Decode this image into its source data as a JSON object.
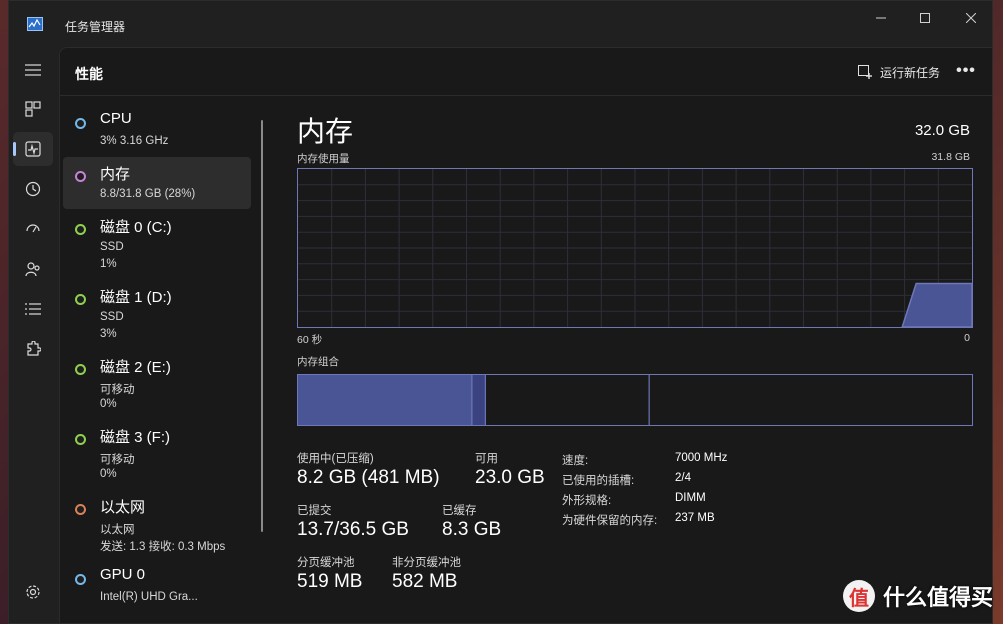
{
  "window": {
    "title": "任务管理器"
  },
  "nav": {
    "items": [
      "menu-icon",
      "processes-icon",
      "performance-icon",
      "app-history-icon",
      "startup-icon",
      "users-icon",
      "details-icon",
      "services-icon",
      "settings-icon"
    ]
  },
  "header": {
    "title": "性能",
    "run_new_task": "运行新任务",
    "more": "•••"
  },
  "resources": [
    {
      "name": "CPU",
      "lines": [
        "3% 3.16 GHz"
      ],
      "color": "#74b9e8"
    },
    {
      "name": "内存",
      "lines": [
        "8.8/31.8 GB (28%)"
      ],
      "color": "#c882d8"
    },
    {
      "name": "磁盘 0 (C:)",
      "lines": [
        "SSD",
        "1%"
      ],
      "color": "#8fd14f"
    },
    {
      "name": "磁盘 1 (D:)",
      "lines": [
        "SSD",
        "3%"
      ],
      "color": "#8fd14f"
    },
    {
      "name": "磁盘 2 (E:)",
      "lines": [
        "可移动",
        "0%"
      ],
      "color": "#8fd14f"
    },
    {
      "name": "磁盘 3 (F:)",
      "lines": [
        "可移动",
        "0%"
      ],
      "color": "#8fd14f"
    },
    {
      "name": "以太网",
      "lines": [
        "以太网",
        "发送: 1.3 接收: 0.3 Mbps"
      ],
      "color": "#d8825a"
    },
    {
      "name": "GPU 0",
      "lines": [
        "Intel(R) UHD Gra..."
      ],
      "color": "#74b9e8"
    }
  ],
  "detail": {
    "title": "内存",
    "total": "32.0 GB",
    "usage_label": "内存使用量",
    "usage_max": "31.8 GB",
    "time_left": "60 秒",
    "time_right": "0",
    "composition_label": "内存组合",
    "composition": {
      "in_use_fraction": 0.258,
      "modified_fraction": 0.02,
      "standby_fraction": 0.243
    },
    "usage_graph": {
      "current_fraction": 0.275
    },
    "stats": {
      "in_use_label": "使用中(已压缩)",
      "in_use_value": "8.2 GB (481 MB)",
      "available_label": "可用",
      "available_value": "23.0 GB",
      "committed_label": "已提交",
      "committed_value": "13.7/36.5 GB",
      "cached_label": "已缓存",
      "cached_value": "8.3 GB",
      "paged_label": "分页缓冲池",
      "paged_value": "519 MB",
      "nonpaged_label": "非分页缓冲池",
      "nonpaged_value": "582 MB"
    },
    "specs": [
      {
        "k": "速度:",
        "v": "7000 MHz"
      },
      {
        "k": "已使用的插槽:",
        "v": "2/4"
      },
      {
        "k": "外形规格:",
        "v": "DIMM"
      },
      {
        "k": "为硬件保留的内存:",
        "v": "237 MB"
      }
    ]
  },
  "watermark": {
    "logo": "值",
    "text": "什么值得买"
  },
  "colors": {
    "accent": "#6e77b8",
    "fill": "#4a5596",
    "nav_active": "#a8c7fa"
  }
}
